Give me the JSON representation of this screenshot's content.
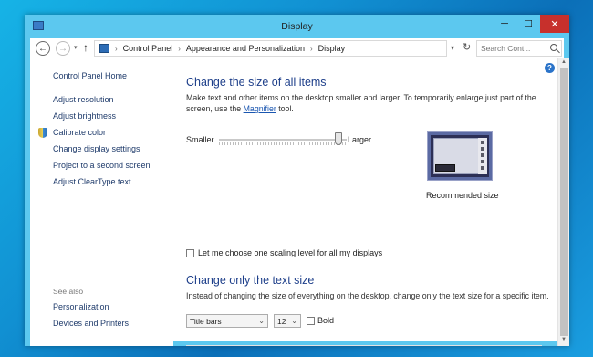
{
  "window": {
    "title": "Display",
    "controls": {
      "minimize": "─",
      "maximize": "☐",
      "close": "✕"
    }
  },
  "address": {
    "breadcrumbs": [
      "Control Panel",
      "Appearance and Personalization",
      "Display"
    ],
    "search_placeholder": "Search Cont..."
  },
  "sidebar": {
    "home": "Control Panel Home",
    "links": [
      "Adjust resolution",
      "Adjust brightness",
      "Calibrate color",
      "Change display settings",
      "Project to a second screen",
      "Adjust ClearType text"
    ],
    "see_also_label": "See also",
    "see_also": [
      "Personalization",
      "Devices and Printers"
    ]
  },
  "main": {
    "section1_title": "Change the size of all items",
    "section1_text_before": "Make text and other items on the desktop smaller and larger. To temporarily enlarge just part of the screen, use the ",
    "section1_link": "Magnifier",
    "section1_text_after": " tool.",
    "slider_min_label": "Smaller",
    "slider_max_label": "Larger",
    "slider_level": 0.92,
    "preview_label": "Recommended size",
    "scaling_checkbox_label": "Let me choose one scaling level for all my displays",
    "scaling_checked": false,
    "section2_title": "Change only the text size",
    "section2_text": "Instead of changing the size of everything on the desktop, change only the text size for a specific item.",
    "item_select_value": "Title bars",
    "size_select_value": "12",
    "bold_label": "Bold",
    "bold_checked": false
  },
  "colors": {
    "accent": "#5cc8ef",
    "close": "#c7302c",
    "heading": "#1e3f8a",
    "link": "#1a56b0"
  }
}
